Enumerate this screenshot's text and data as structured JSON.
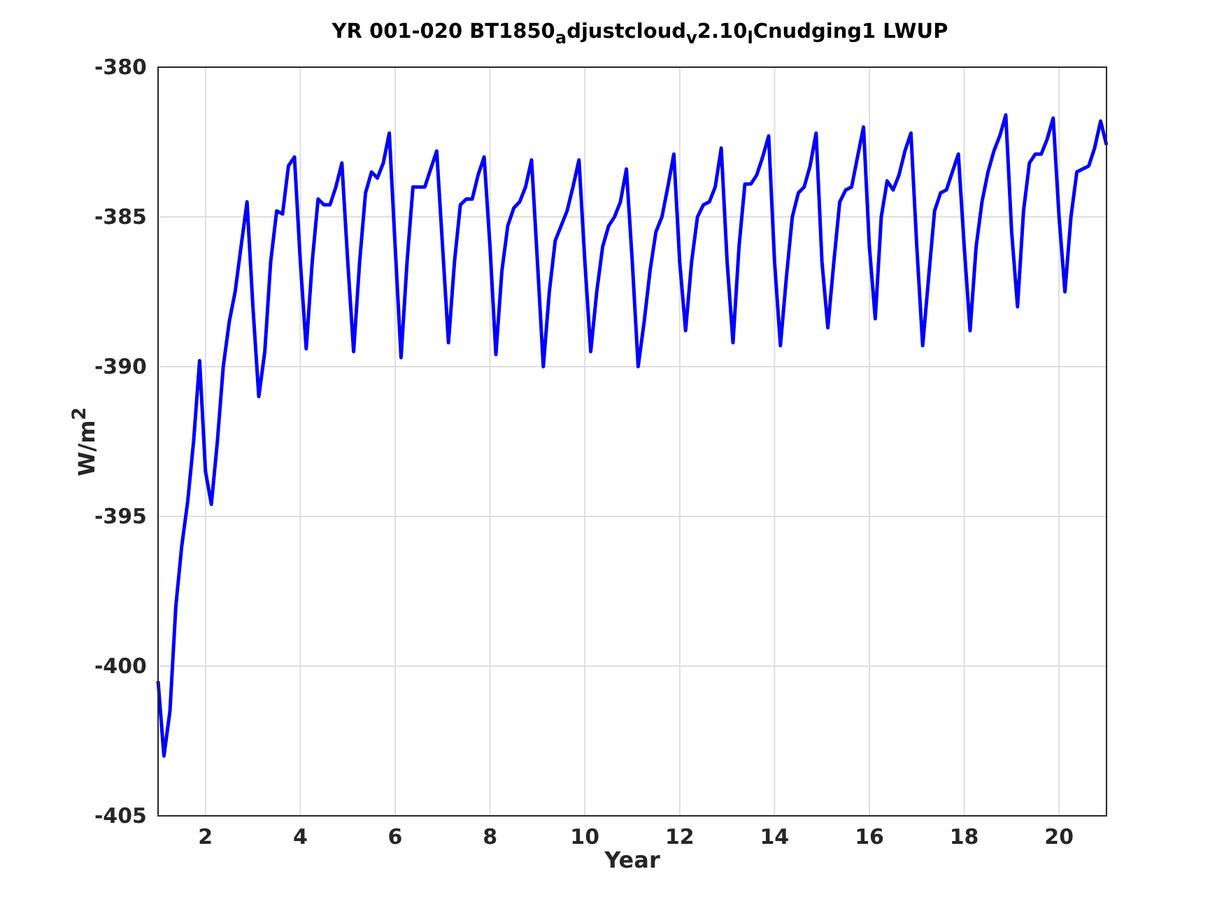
{
  "figure": {
    "chart_data": {
      "type": "line",
      "title": "YR 001-020 BT1850$_{a}$djustcloud$_{v}$2.10$_{l}$Cnudging1 LWUP",
      "xlabel": "Year",
      "ylabel": "W/m$^{2}$",
      "xlim": [
        1,
        21
      ],
      "ylim": [
        -405,
        -380
      ],
      "xticks": [
        2,
        4,
        6,
        8,
        10,
        12,
        14,
        16,
        18,
        20
      ],
      "yticks": [
        -405,
        -400,
        -395,
        -390,
        -385,
        -380
      ],
      "x": [
        1,
        1.125,
        1.25,
        1.375,
        1.5,
        1.625,
        1.75,
        1.875,
        2,
        2.125,
        2.25,
        2.375,
        2.5,
        2.625,
        2.75,
        2.875,
        3,
        3.125,
        3.25,
        3.375,
        3.5,
        3.625,
        3.75,
        3.875,
        4,
        4.125,
        4.25,
        4.375,
        4.5,
        4.625,
        4.75,
        4.875,
        5,
        5.125,
        5.25,
        5.375,
        5.5,
        5.625,
        5.75,
        5.875,
        6,
        6.125,
        6.25,
        6.375,
        6.5,
        6.625,
        6.75,
        6.875,
        7,
        7.125,
        7.25,
        7.375,
        7.5,
        7.625,
        7.75,
        7.875,
        8,
        8.125,
        8.25,
        8.375,
        8.5,
        8.625,
        8.75,
        8.875,
        9,
        9.125,
        9.25,
        9.375,
        9.5,
        9.625,
        9.75,
        9.875,
        10,
        10.125,
        10.25,
        10.375,
        10.5,
        10.625,
        10.75,
        10.875,
        11,
        11.125,
        11.25,
        11.375,
        11.5,
        11.625,
        11.75,
        11.875,
        12,
        12.125,
        12.25,
        12.375,
        12.5,
        12.625,
        12.75,
        12.875,
        13,
        13.125,
        13.25,
        13.375,
        13.5,
        13.625,
        13.75,
        13.875,
        14,
        14.125,
        14.25,
        14.375,
        14.5,
        14.625,
        14.75,
        14.875,
        15,
        15.125,
        15.25,
        15.375,
        15.5,
        15.625,
        15.75,
        15.875,
        16,
        16.125,
        16.25,
        16.375,
        16.5,
        16.625,
        16.75,
        16.875,
        17,
        17.125,
        17.25,
        17.375,
        17.5,
        17.625,
        17.75,
        17.875,
        18,
        18.125,
        18.25,
        18.375,
        18.5,
        18.625,
        18.75,
        18.875,
        19,
        19.125,
        19.25,
        19.375,
        19.5,
        19.625,
        19.75,
        19.875,
        20,
        20.125,
        20.25,
        20.375,
        20.5,
        20.625,
        20.75,
        20.875,
        21
      ],
      "grid": true,
      "series": [
        {
          "color": "#0000ff",
          "values": [
            -400.5,
            -403,
            -401.5,
            -398,
            -396,
            -394.5,
            -392.5,
            -389.8,
            -393.5,
            -394.6,
            -392.5,
            -390,
            -388.5,
            -387.5,
            -386,
            -384.5,
            -388,
            -391,
            -389.5,
            -386.5,
            -384.8,
            -384.9,
            -383.3,
            -383,
            -386.5,
            -389.4,
            -386.5,
            -384.4,
            -384.6,
            -384.6,
            -384,
            -383.2,
            -386.5,
            -389.5,
            -386.5,
            -384.2,
            -383.5,
            -383.7,
            -383.2,
            -382.2,
            -386,
            -389.7,
            -386.5,
            -384,
            -384,
            -384,
            -383.4,
            -382.8,
            -386,
            -389.2,
            -386.5,
            -384.6,
            -384.4,
            -384.4,
            -383.6,
            -383,
            -386,
            -389.6,
            -386.8,
            -385.3,
            -384.7,
            -384.5,
            -384,
            -383.1,
            -386.5,
            -390,
            -387.5,
            -385.8,
            -385.3,
            -384.8,
            -384,
            -383.1,
            -386.5,
            -389.5,
            -387.5,
            -386,
            -385.3,
            -385,
            -384.5,
            -383.4,
            -386.5,
            -390,
            -388.5,
            -386.8,
            -385.5,
            -385,
            -384,
            -382.9,
            -386.5,
            -388.8,
            -386.5,
            -385,
            -384.6,
            -384.5,
            -384,
            -382.7,
            -386.5,
            -389.2,
            -386,
            -383.9,
            -383.9,
            -383.6,
            -383,
            -382.3,
            -386.5,
            -389.3,
            -387,
            -385,
            -384.2,
            -384,
            -383.3,
            -382.2,
            -386.5,
            -388.7,
            -386.5,
            -384.5,
            -384.1,
            -384,
            -383,
            -382,
            -386,
            -388.4,
            -385,
            -383.8,
            -384.1,
            -383.6,
            -382.8,
            -382.2,
            -386,
            -389.3,
            -387,
            -384.8,
            -384.2,
            -384.1,
            -383.5,
            -382.9,
            -386,
            -388.8,
            -386,
            -384.5,
            -383.5,
            -382.8,
            -382.3,
            -381.6,
            -385.5,
            -388,
            -384.8,
            -383.2,
            -382.9,
            -382.9,
            -382.4,
            -381.7,
            -385,
            -387.5,
            -385,
            -383.5,
            -383.4,
            -383.3,
            -382.7,
            -381.8,
            -382.6
          ]
        }
      ]
    }
  }
}
